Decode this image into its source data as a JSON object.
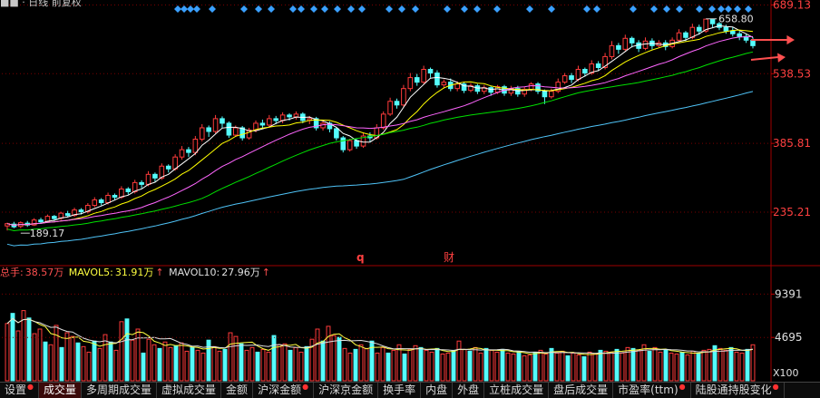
{
  "title_fragment": "■■ · 日线 前复权",
  "price_axis": {
    "labels": [
      "689.13",
      "538.53",
      "385.81",
      "235.21"
    ],
    "prices": [
      689.13,
      538.53,
      385.81,
      235.21
    ],
    "min": 120,
    "max": 700
  },
  "annotations": {
    "high_label": "658.80",
    "high_price": 658.8,
    "low_label": "189.17",
    "low_price": 189.17,
    "event_q": "q",
    "event_cai": "财"
  },
  "volume_header": {
    "total_label": "总手:",
    "total_value": "38.57万",
    "ma5_label": "MAVOL5:",
    "ma5_value": "31.91万",
    "ma10_label": "MAVOL10:",
    "ma10_value": "27.96万",
    "arrow": "↑"
  },
  "volume_axis": {
    "labels": [
      "9391",
      "4695"
    ],
    "unit": "X100"
  },
  "tabs": [
    {
      "label": "设置",
      "dot": true
    },
    {
      "label": "成交量",
      "active": true
    },
    {
      "label": "多周期成交量"
    },
    {
      "label": "虚拟成交量"
    },
    {
      "label": "金额"
    },
    {
      "label": "沪深金额",
      "dot": true
    },
    {
      "label": "沪深京金额"
    },
    {
      "label": "换手率"
    },
    {
      "label": "内盘"
    },
    {
      "label": "外盘"
    },
    {
      "label": "立桩成交量"
    },
    {
      "label": "盘后成交量"
    },
    {
      "label": "市盈率(ttm)",
      "dot": true
    },
    {
      "label": "陆股通持股变化",
      "dot": true
    }
  ],
  "colors": {
    "up": "#ff3b3b",
    "down": "#54fcfc",
    "ma5": "#ffffff",
    "ma10": "#ffff00",
    "ma20": "#ff66ff",
    "ma30": "#00e000",
    "ma60": "#4fc3f7",
    "grid": "#7a0000",
    "event_diamond": "#3aa0ff"
  },
  "chart_data": {
    "type": "candlestick",
    "price_axis_ticks": [
      689.13,
      538.53,
      385.81,
      235.21
    ],
    "volume_axis_ticks": [
      9391,
      4695
    ],
    "candles": [
      [
        205,
        210,
        195,
        212
      ],
      [
        209,
        203,
        200,
        214
      ],
      [
        204,
        212,
        200,
        215
      ],
      [
        211,
        207,
        203,
        216
      ],
      [
        207,
        218,
        205,
        222
      ],
      [
        218,
        214,
        210,
        223
      ],
      [
        215,
        226,
        212,
        230
      ],
      [
        226,
        221,
        216,
        229
      ],
      [
        222,
        233,
        218,
        236
      ],
      [
        232,
        228,
        224,
        238
      ],
      [
        228,
        240,
        225,
        245
      ],
      [
        240,
        236,
        230,
        244
      ],
      [
        236,
        250,
        232,
        255
      ],
      [
        250,
        262,
        246,
        268
      ],
      [
        262,
        256,
        250,
        266
      ],
      [
        256,
        272,
        252,
        278
      ],
      [
        272,
        268,
        262,
        276
      ],
      [
        268,
        286,
        264,
        292
      ],
      [
        286,
        280,
        274,
        290
      ],
      [
        280,
        300,
        276,
        306
      ],
      [
        300,
        296,
        288,
        305
      ],
      [
        296,
        318,
        292,
        325
      ],
      [
        318,
        310,
        302,
        322
      ],
      [
        310,
        336,
        306,
        342
      ],
      [
        336,
        330,
        322,
        340
      ],
      [
        330,
        356,
        326,
        362
      ],
      [
        356,
        372,
        350,
        380
      ],
      [
        372,
        366,
        356,
        378
      ],
      [
        366,
        395,
        360,
        402
      ],
      [
        395,
        420,
        390,
        428
      ],
      [
        420,
        412,
        400,
        425
      ],
      [
        412,
        440,
        408,
        448
      ],
      [
        440,
        430,
        420,
        445
      ],
      [
        430,
        404,
        398,
        434
      ],
      [
        404,
        420,
        400,
        425
      ],
      [
        420,
        398,
        392,
        424
      ],
      [
        398,
        415,
        394,
        420
      ],
      [
        415,
        430,
        410,
        436
      ],
      [
        430,
        426,
        418,
        438
      ],
      [
        426,
        440,
        420,
        448
      ],
      [
        440,
        436,
        428,
        446
      ],
      [
        436,
        448,
        430,
        454
      ],
      [
        448,
        444,
        436,
        452
      ],
      [
        444,
        450,
        438,
        456
      ],
      [
        450,
        436,
        430,
        454
      ],
      [
        436,
        440,
        428,
        446
      ],
      [
        440,
        420,
        414,
        444
      ],
      [
        420,
        430,
        414,
        436
      ],
      [
        430,
        418,
        410,
        434
      ],
      [
        418,
        398,
        392,
        422
      ],
      [
        398,
        372,
        366,
        402
      ],
      [
        372,
        392,
        368,
        396
      ],
      [
        392,
        380,
        374,
        396
      ],
      [
        380,
        402,
        376,
        410
      ],
      [
        402,
        398,
        390,
        410
      ],
      [
        398,
        420,
        394,
        428
      ],
      [
        420,
        450,
        416,
        456
      ],
      [
        450,
        478,
        446,
        486
      ],
      [
        478,
        470,
        462,
        484
      ],
      [
        470,
        506,
        466,
        514
      ],
      [
        506,
        530,
        500,
        540
      ],
      [
        530,
        520,
        512,
        538
      ],
      [
        520,
        548,
        516,
        556
      ],
      [
        548,
        540,
        530,
        552
      ],
      [
        540,
        514,
        508,
        546
      ],
      [
        514,
        520,
        506,
        526
      ],
      [
        520,
        506,
        500,
        528
      ],
      [
        506,
        516,
        500,
        522
      ],
      [
        516,
        502,
        496,
        520
      ],
      [
        502,
        512,
        498,
        518
      ],
      [
        512,
        500,
        494,
        516
      ],
      [
        500,
        508,
        494,
        514
      ],
      [
        508,
        498,
        490,
        512
      ],
      [
        498,
        510,
        494,
        514
      ],
      [
        510,
        496,
        490,
        514
      ],
      [
        496,
        506,
        490,
        512
      ],
      [
        506,
        494,
        488,
        512
      ],
      [
        494,
        504,
        488,
        510
      ],
      [
        504,
        516,
        500,
        520
      ],
      [
        516,
        500,
        494,
        520
      ],
      [
        500,
        488,
        472,
        504
      ],
      [
        488,
        500,
        484,
        506
      ],
      [
        500,
        520,
        496,
        528
      ],
      [
        520,
        534,
        516,
        540
      ],
      [
        534,
        526,
        518,
        540
      ],
      [
        526,
        548,
        522,
        556
      ],
      [
        548,
        540,
        532,
        552
      ],
      [
        540,
        560,
        536,
        568
      ],
      [
        560,
        552,
        544,
        566
      ],
      [
        552,
        576,
        548,
        584
      ],
      [
        576,
        600,
        570,
        610
      ],
      [
        600,
        592,
        582,
        606
      ],
      [
        592,
        616,
        588,
        624
      ],
      [
        616,
        606,
        596,
        620
      ],
      [
        606,
        594,
        586,
        612
      ],
      [
        594,
        610,
        590,
        618
      ],
      [
        610,
        600,
        592,
        616
      ],
      [
        600,
        606,
        596,
        612
      ],
      [
        606,
        598,
        590,
        612
      ],
      [
        598,
        612,
        594,
        618
      ],
      [
        612,
        628,
        608,
        636
      ],
      [
        628,
        618,
        610,
        632
      ],
      [
        618,
        640,
        614,
        648
      ],
      [
        640,
        632,
        624,
        646
      ],
      [
        632,
        658,
        628,
        658
      ],
      [
        658,
        648,
        640,
        658
      ],
      [
        648,
        640,
        634,
        652
      ],
      [
        640,
        632,
        626,
        646
      ],
      [
        632,
        626,
        620,
        640
      ],
      [
        626,
        620,
        612,
        632
      ],
      [
        620,
        612,
        606,
        626
      ],
      [
        612,
        600,
        594,
        618
      ]
    ],
    "volumes": [
      6200,
      7300,
      5400,
      7600,
      6800,
      5100,
      5600,
      4200,
      3900,
      6000,
      3600,
      5200,
      4800,
      4100,
      3700,
      3100,
      4300,
      3500,
      5000,
      4200,
      3300,
      6400,
      6700,
      4400,
      5600,
      3000,
      4500,
      3900,
      3500,
      4200,
      3600,
      3800,
      4100,
      3200,
      3600,
      3300,
      3000,
      4400,
      3700,
      3200,
      3400,
      5200,
      4800,
      4000,
      3300,
      3600,
      3100,
      3400,
      3100,
      4900,
      3900,
      4000,
      3300,
      3600,
      3100,
      3700,
      4500,
      5600,
      4300,
      5900,
      4900,
      4700,
      3500,
      3000,
      3400,
      3900,
      3500,
      4300,
      3000,
      3600,
      3000,
      3300,
      3900,
      2900,
      3400,
      3800,
      3600,
      3300,
      3100,
      3500,
      2900,
      3000,
      3300,
      4300,
      3400,
      3200,
      3600,
      3000,
      3500,
      3300,
      3100,
      3400,
      3000,
      2900,
      3200,
      2700,
      2800,
      3100,
      3300,
      2900,
      3500,
      3000,
      3200,
      2700,
      3000,
      2800,
      2600,
      3100,
      2900,
      3300,
      3200,
      3100,
      3400,
      3000,
      3600,
      3500,
      3300,
      3900,
      3200,
      3600,
      3100,
      3400,
      3000,
      2900,
      3100,
      2800,
      3200,
      3000,
      3300,
      3400,
      3800,
      3500,
      3300,
      3600,
      3100,
      3000,
      3400,
      3900
    ]
  }
}
